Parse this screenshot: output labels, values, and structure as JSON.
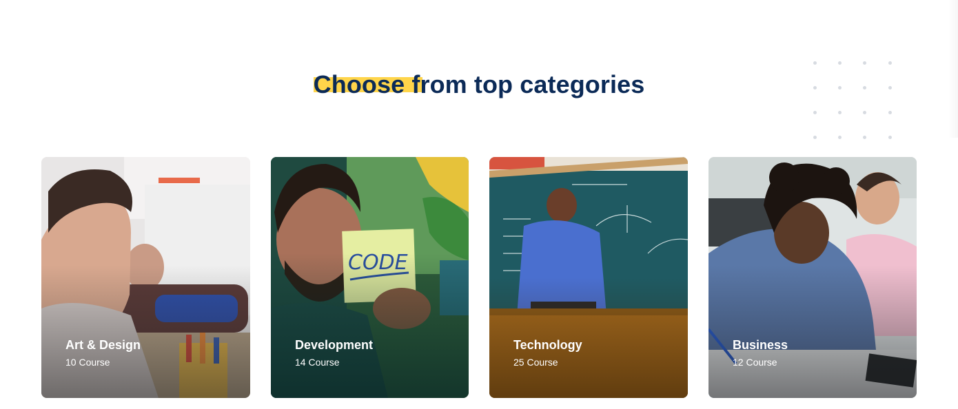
{
  "section": {
    "title": "Choose from top categories"
  },
  "categories": [
    {
      "name": "Art & Design",
      "count": "10 Course",
      "image": "art-design-photo"
    },
    {
      "name": "Development",
      "count": "14 Course",
      "image": "development-photo"
    },
    {
      "name": "Technology",
      "count": "25 Course",
      "image": "technology-photo"
    },
    {
      "name": "Business",
      "count": "12 Course",
      "image": "business-photo"
    }
  ],
  "colors": {
    "title": "#0b2a57",
    "highlight": "#ffd54a",
    "card_text": "#ffffff",
    "dots": "#d7dbe1"
  }
}
